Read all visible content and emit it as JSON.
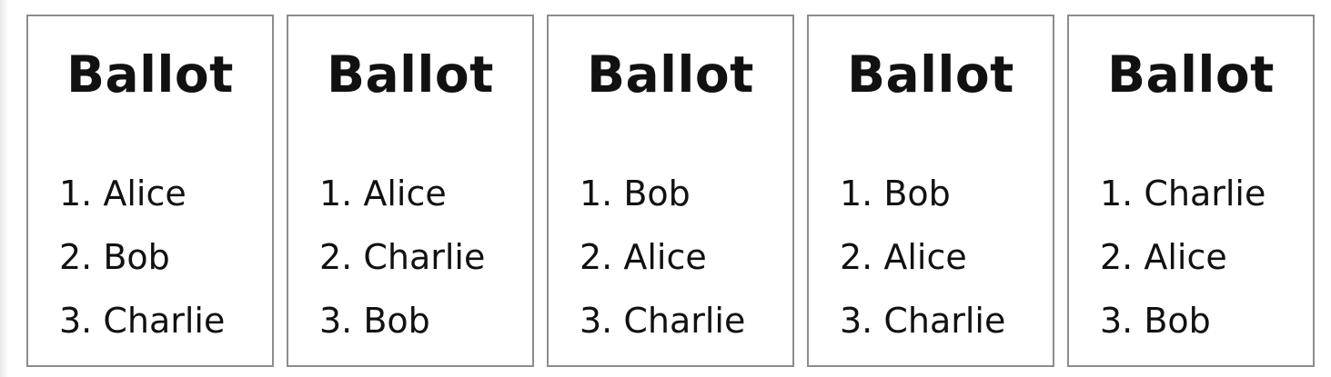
{
  "ballots": [
    {
      "title": "Ballot",
      "rankings": [
        "1. Alice",
        "2. Bob",
        "3. Charlie"
      ]
    },
    {
      "title": "Ballot",
      "rankings": [
        "1. Alice",
        "2. Charlie",
        "3. Bob"
      ]
    },
    {
      "title": "Ballot",
      "rankings": [
        "1. Bob",
        "2. Alice",
        "3. Charlie"
      ]
    },
    {
      "title": "Ballot",
      "rankings": [
        "1. Bob",
        "2. Alice",
        "3. Charlie"
      ]
    },
    {
      "title": "Ballot",
      "rankings": [
        "1. Charlie",
        "2. Alice",
        "3. Bob"
      ]
    }
  ]
}
